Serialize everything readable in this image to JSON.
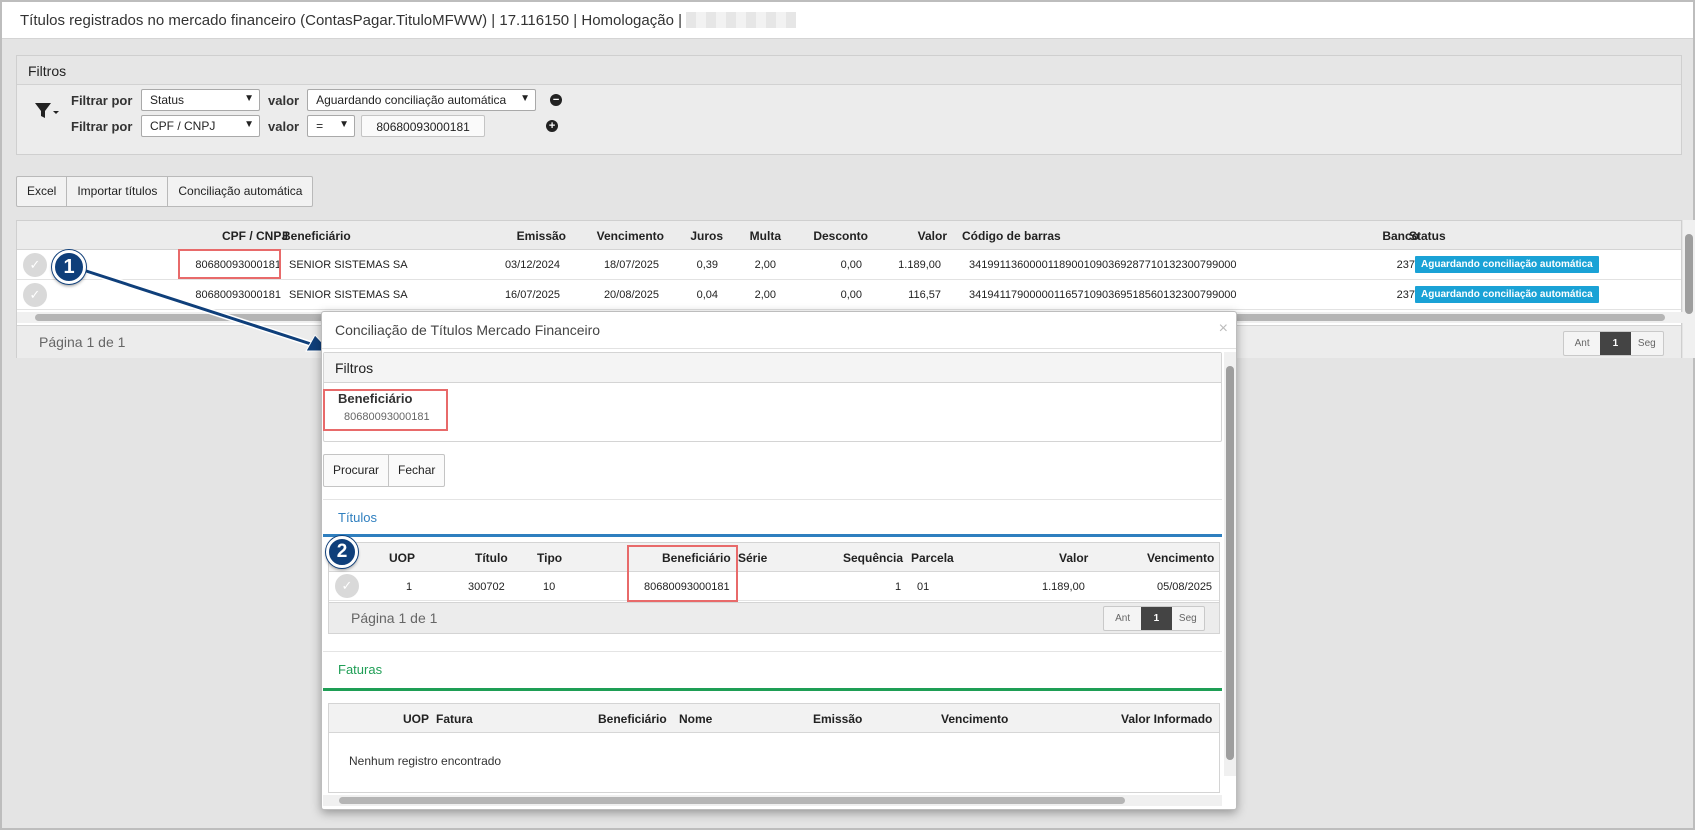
{
  "window": {
    "title": "Títulos registrados no mercado financeiro (ContasPagar.TituloMFWW) | 17.116150 | Homologação |"
  },
  "filters": {
    "header": "Filtros",
    "filter_by_label": "Filtrar por",
    "value_label": "valor",
    "row1": {
      "field": "Status",
      "value": "Aguardando conciliação automática"
    },
    "row2": {
      "field": "CPF / CNPJ",
      "operator": "=",
      "value": "80680093000181"
    }
  },
  "toolbar": {
    "excel": "Excel",
    "import": "Importar títulos",
    "auto_reconcile": "Conciliação automática"
  },
  "main_grid": {
    "columns": {
      "cpf": "CPF / CNPJ",
      "beneficiary": "Beneficiário",
      "issue": "Emissão",
      "due": "Vencimento",
      "interest": "Juros",
      "fine": "Multa",
      "discount": "Desconto",
      "value": "Valor",
      "barcode": "Código de barras",
      "bank": "Banco",
      "status": "Status"
    },
    "rows": [
      {
        "cpf": "80680093000181",
        "beneficiary": "SENIOR SISTEMAS SA",
        "issue": "03/12/2024",
        "due": "18/07/2025",
        "interest": "0,39",
        "fine": "2,00",
        "discount": "0,00",
        "value": "1.189,00",
        "barcode": "34199113600001189001090369287710132300799000",
        "bank": "237",
        "status": "Aguardando conciliação automática"
      },
      {
        "cpf": "80680093000181",
        "beneficiary": "SENIOR SISTEMAS SA",
        "issue": "16/07/2025",
        "due": "20/08/2025",
        "interest": "0,04",
        "fine": "2,00",
        "discount": "0,00",
        "value": "116,57",
        "barcode": "34194117900000116571090369518560132300799000",
        "bank": "237",
        "status": "Aguardando conciliação automática"
      }
    ],
    "page_info": "Página 1 de 1",
    "pager": {
      "prev": "Ant",
      "current": "1",
      "next": "Seg"
    }
  },
  "markers": {
    "one": "1",
    "two": "2"
  },
  "modal": {
    "title": "Conciliação de Títulos Mercado Financeiro",
    "close": "×",
    "filters_header": "Filtros",
    "beneficiary_label": "Beneficiário",
    "beneficiary_value": "80680093000181",
    "search": "Procurar",
    "close_button": "Fechar",
    "titles_section": "Títulos",
    "titles_grid": {
      "columns": {
        "uop": "UOP",
        "title": "Título",
        "type": "Tipo",
        "beneficiary": "Beneficiário",
        "series": "Série",
        "sequence": "Sequência",
        "installment": "Parcela",
        "value": "Valor",
        "due": "Vencimento"
      },
      "rows": [
        {
          "uop": "1",
          "title": "300702",
          "type": "10",
          "beneficiary": "80680093000181",
          "series": "",
          "sequence": "1",
          "installment": "01",
          "value": "1.189,00",
          "due": "05/08/2025"
        }
      ],
      "page_info": "Página 1 de 1",
      "pager": {
        "prev": "Ant",
        "current": "1",
        "next": "Seg"
      }
    },
    "invoices_section": "Faturas",
    "invoices_grid": {
      "columns": {
        "uop": "UOP",
        "invoice": "Fatura",
        "beneficiary": "Beneficiário",
        "name": "Nome",
        "issue": "Emissão",
        "due": "Vencimento",
        "informed_value": "Valor Informado"
      },
      "empty": "Nenhum registro encontrado"
    }
  },
  "colors": {
    "status_badge": "#1aa2d6",
    "titles_accent": "#2f7fbf",
    "invoices_accent": "#1e9e55",
    "highlight": "#e86a6a",
    "marker": "#0f3f7a"
  }
}
